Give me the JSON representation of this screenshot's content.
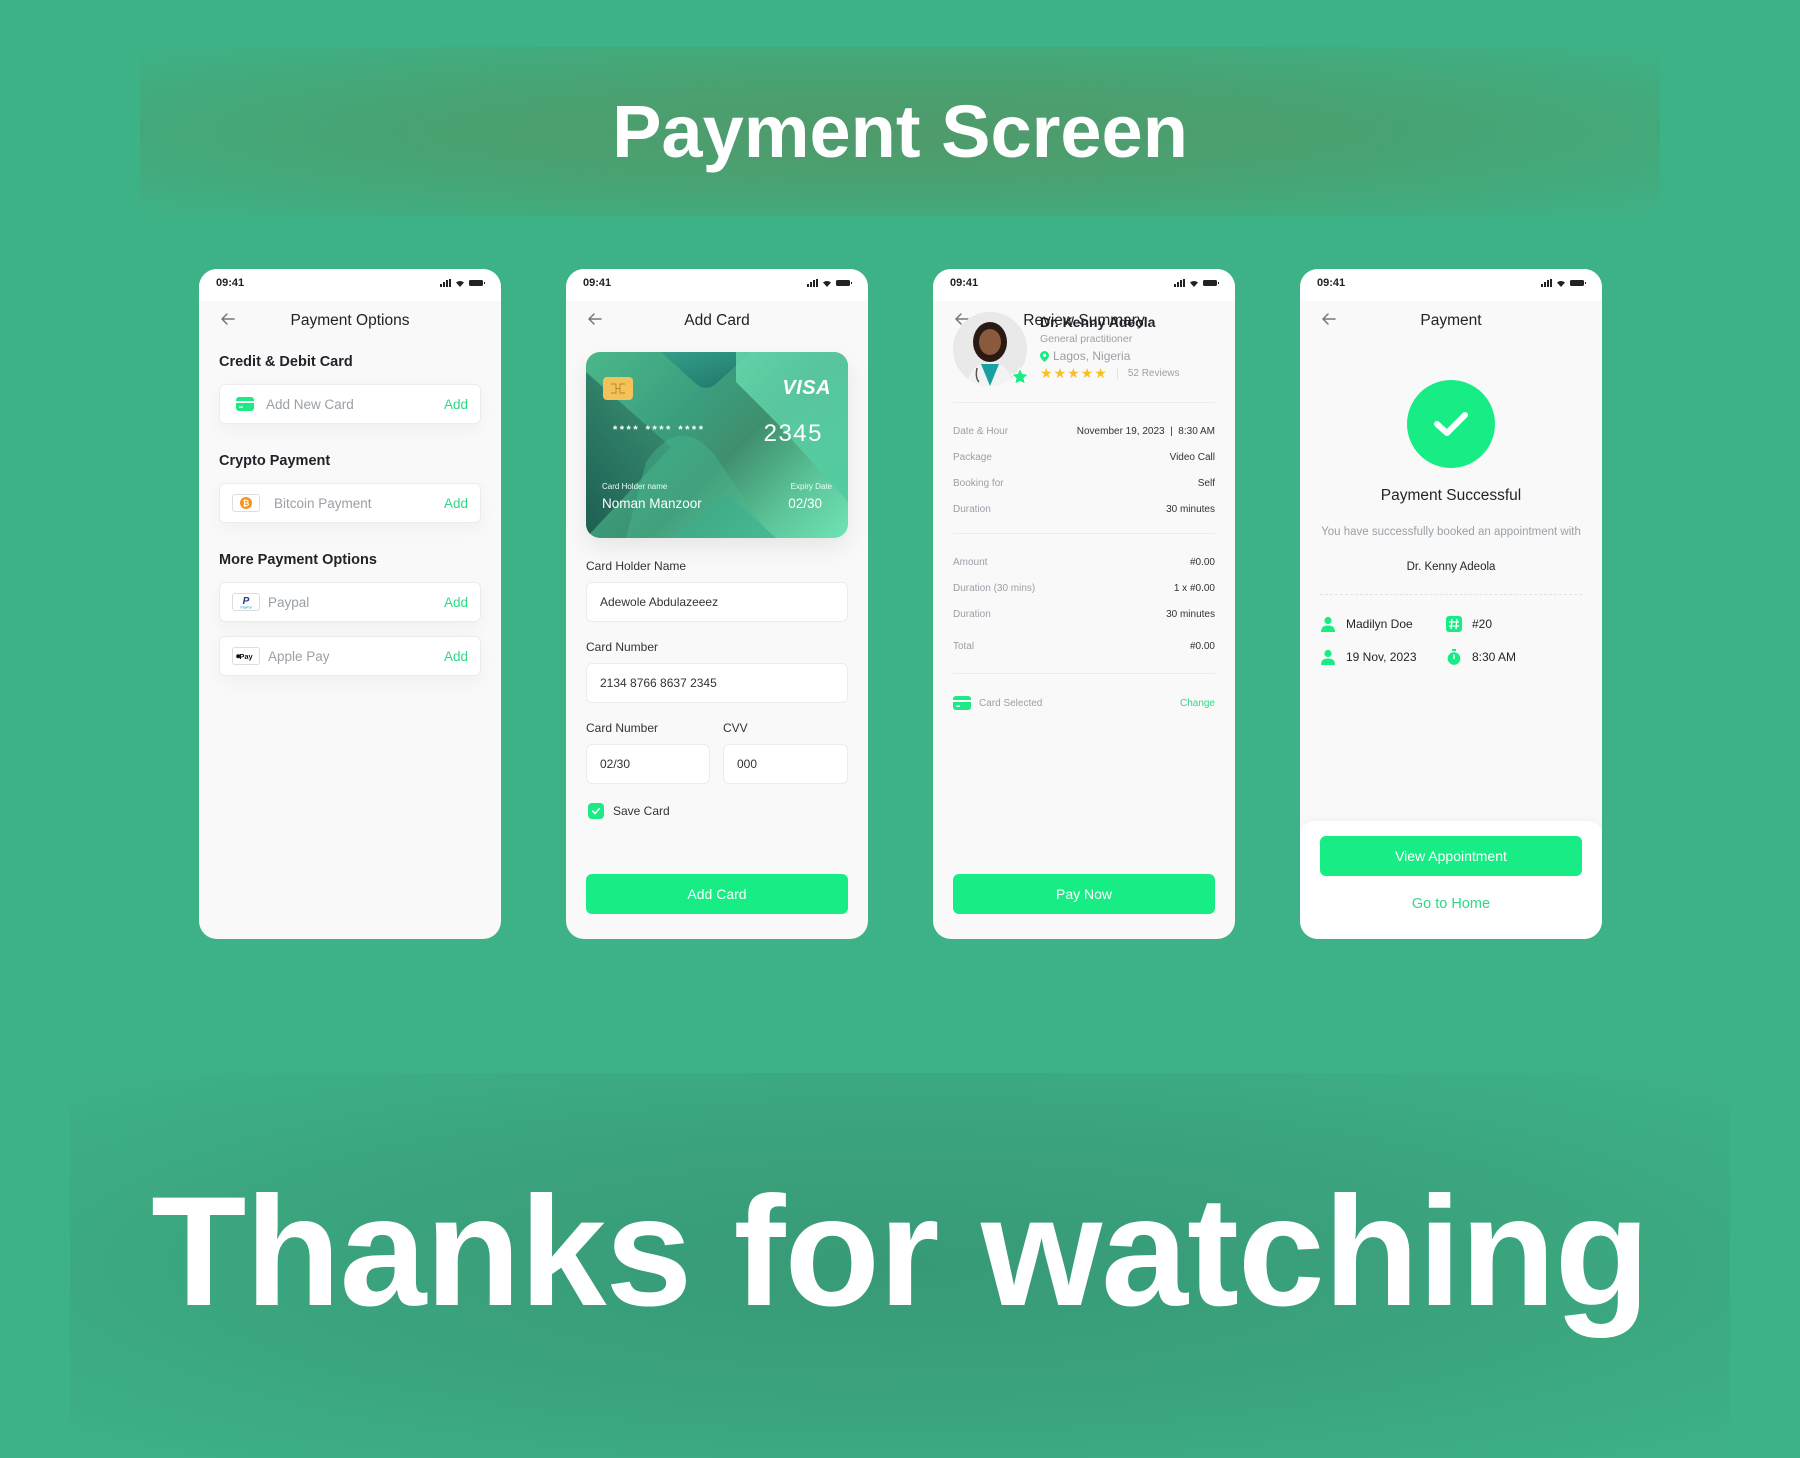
{
  "page": {
    "title": "Payment Screen",
    "footer": "Thanks for watching"
  },
  "colors": {
    "background": "#3eb287",
    "accent": "#18ec85",
    "accent_text": "#2fd984",
    "star": "#fbbf24"
  },
  "status_bar": {
    "time": "09:41",
    "icons": [
      "signal-icon",
      "wifi-icon",
      "battery-icon"
    ]
  },
  "screens": {
    "payment_options": {
      "title": "Payment Options",
      "sections": [
        {
          "title": "Credit & Debit Card",
          "items": [
            {
              "label": "Add New Card",
              "icon": "credit-card-icon",
              "action": "Add"
            }
          ]
        },
        {
          "title": "Crypto Payment",
          "items": [
            {
              "label": "Bitcoin Payment",
              "icon": "bitcoin-icon",
              "action": "Add"
            }
          ]
        },
        {
          "title": "More Payment Options",
          "items": [
            {
              "label": "Paypal",
              "icon": "paypal-icon",
              "action": "Add"
            },
            {
              "label": "Apple Pay",
              "icon": "apple-pay-icon",
              "action": "Add"
            }
          ]
        }
      ]
    },
    "add_card": {
      "title": "Add Card",
      "card": {
        "brand": "VISA",
        "masked": "**** **** ****",
        "last4": "2345",
        "holder_label": "Card Holder name",
        "holder_name": "Noman Manzoor",
        "expiry_label": "Expiry Date",
        "expiry": "02/30"
      },
      "fields": {
        "holder_name": {
          "label": "Card Holder Name",
          "value": "Adewole Abdulazeeez"
        },
        "card_number": {
          "label": "Card Number",
          "value": "2134 8766 8637 2345"
        },
        "expiry": {
          "label": "Card Number",
          "value": "02/30"
        },
        "cvv": {
          "label": "CVV",
          "value": "000"
        }
      },
      "save_card": {
        "label": "Save Card",
        "checked": true
      },
      "submit_label": "Add Card"
    },
    "review_summary": {
      "title": "Review Summary",
      "doctor": {
        "name": "Dr. Kenny Adeola",
        "specialty": "General practitioner",
        "location": "Lagos, Nigeria",
        "rating": 5,
        "rating_max": 5,
        "reviews": "52 Reviews"
      },
      "details": [
        {
          "label": "Date & Hour",
          "value": "November 19, 2023  |  8:30 AM"
        },
        {
          "label": "Package",
          "value": "Video Call"
        },
        {
          "label": "Booking for",
          "value": "Self"
        },
        {
          "label": "Duration",
          "value": "30 minutes"
        }
      ],
      "pricing": [
        {
          "label": "Amount",
          "value": "#0.00"
        },
        {
          "label": "Duration (30 mins)",
          "value": "1 x #0.00"
        },
        {
          "label": "Duration",
          "value": "30 minutes"
        },
        {
          "label": "Total",
          "value": "#0.00"
        }
      ],
      "payment_method": {
        "label": "Card Selected",
        "action": "Change"
      },
      "submit_label": "Pay Now"
    },
    "payment_success": {
      "title": "Payment",
      "heading": "Payment Successful",
      "message": "You have successfully booked an appointment with",
      "doctor": "Dr. Kenny Adeola",
      "info": {
        "patient": "Madilyn Doe",
        "number": "#20",
        "date": "19 Nov, 2023",
        "time": "8:30 AM"
      },
      "primary_label": "View Appointment",
      "secondary_label": "Go to Home"
    }
  }
}
